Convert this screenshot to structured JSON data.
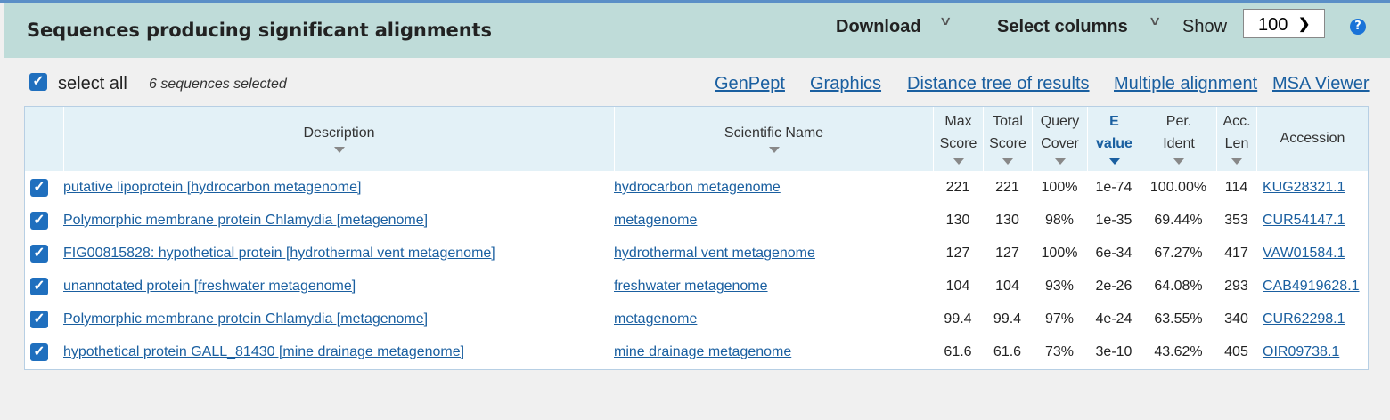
{
  "header": {
    "title": "Sequences producing significant alignments",
    "download_label": "Download",
    "select_columns_label": "Select columns",
    "show_label": "Show",
    "show_value": "100",
    "help_label": "?"
  },
  "selection": {
    "select_all_label": "select all",
    "count_text": "6 sequences selected"
  },
  "links": {
    "genpept": "GenPept",
    "graphics": "Graphics",
    "distance_tree": "Distance tree of results",
    "multiple_alignment": "Multiple alignment",
    "msa_viewer": "MSA Viewer"
  },
  "columns": {
    "description": "Description",
    "scientific_name": "Scientific Name",
    "max_score_1": "Max",
    "max_score_2": "Score",
    "total_score_1": "Total",
    "total_score_2": "Score",
    "query_cover_1": "Query",
    "query_cover_2": "Cover",
    "e_value_1": "E",
    "e_value_2": "value",
    "per_ident_1": "Per.",
    "per_ident_2": "Ident",
    "acc_len_1": "Acc.",
    "acc_len_2": "Len",
    "accession": "Accession"
  },
  "rows": [
    {
      "description": "putative lipoprotein [hydrocarbon metagenome]",
      "scientific_name": "hydrocarbon metagenome",
      "max_score": "221",
      "total_score": "221",
      "query_cover": "100%",
      "e_value": "1e-74",
      "per_ident": "100.00%",
      "acc_len": "114",
      "accession": "KUG28321.1"
    },
    {
      "description": "Polymorphic membrane protein Chlamydia [metagenome]",
      "scientific_name": "metagenome",
      "max_score": "130",
      "total_score": "130",
      "query_cover": "98%",
      "e_value": "1e-35",
      "per_ident": "69.44%",
      "acc_len": "353",
      "accession": "CUR54147.1"
    },
    {
      "description": "FIG00815828: hypothetical protein [hydrothermal vent metagenome]",
      "scientific_name": "hydrothermal vent metagenome",
      "max_score": "127",
      "total_score": "127",
      "query_cover": "100%",
      "e_value": "6e-34",
      "per_ident": "67.27%",
      "acc_len": "417",
      "accession": "VAW01584.1"
    },
    {
      "description": "unannotated protein [freshwater metagenome]",
      "scientific_name": "freshwater metagenome",
      "max_score": "104",
      "total_score": "104",
      "query_cover": "93%",
      "e_value": "2e-26",
      "per_ident": "64.08%",
      "acc_len": "293",
      "accession": "CAB4919628.1"
    },
    {
      "description": "Polymorphic membrane protein Chlamydia [metagenome]",
      "scientific_name": "metagenome",
      "max_score": "99.4",
      "total_score": "99.4",
      "query_cover": "97%",
      "e_value": "4e-24",
      "per_ident": "63.55%",
      "acc_len": "340",
      "accession": "CUR62298.1"
    },
    {
      "description": "hypothetical protein GALL_81430 [mine drainage metagenome]",
      "scientific_name": "mine drainage metagenome",
      "max_score": "61.6",
      "total_score": "61.6",
      "query_cover": "73%",
      "e_value": "3e-10",
      "per_ident": "43.62%",
      "acc_len": "405",
      "accession": "OIR09738.1"
    }
  ],
  "checkbox_glyph": "✓",
  "colors": {
    "accent": "#1f6fbe",
    "header_bg": "#bfdcd9",
    "link": "#1a5fa0"
  }
}
